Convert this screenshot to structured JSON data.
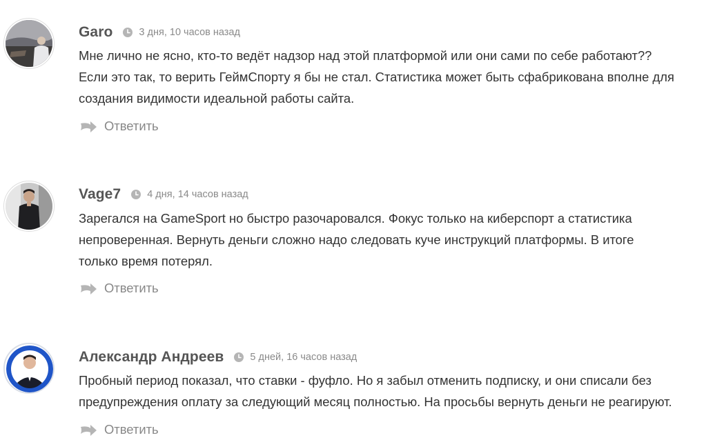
{
  "comments": [
    {
      "author": "Garo",
      "date": "3 дня, 10 часов назад",
      "lines": [
        "Мне лично не ясно, кто-то ведёт надзор над этой платформой или они сами по себе работают??",
        "Если это так, то верить ГеймСпорту я бы не стал. Статистика может быть сфабрикована вполне для",
        "создания видимости идеальной работы сайта."
      ],
      "reply_label": "Ответить"
    },
    {
      "author": "Vage7",
      "date": "4 дня, 14 часов назад",
      "lines": [
        "Зарегался на GameSport но быстро разочаровался. Фокус только на киберспорт а статистика",
        "непроверенная. Вернуть деньги сложно надо следовать куче инструкций платформы. В итоге",
        "только время потерял."
      ],
      "reply_label": "Ответить"
    },
    {
      "author": "Александр Андреев",
      "date": "5 дней, 16 часов назад",
      "lines": [
        "Пробный период показал, что ставки - фуфло. Но я забыл отменить подписку, и они списали без",
        "предупреждения оплату за следующий месяц полностью. На просьбы вернуть деньги не реагируют."
      ],
      "reply_label": "Ответить"
    }
  ],
  "icons": {
    "clock": "clock-icon",
    "reply": "reply-arrow-icon",
    "avatar": "avatar"
  },
  "colors": {
    "author": "#555555",
    "meta": "#8a8a8a",
    "text": "#333333",
    "reply": "#888888",
    "icon": "#b5b5b5"
  }
}
